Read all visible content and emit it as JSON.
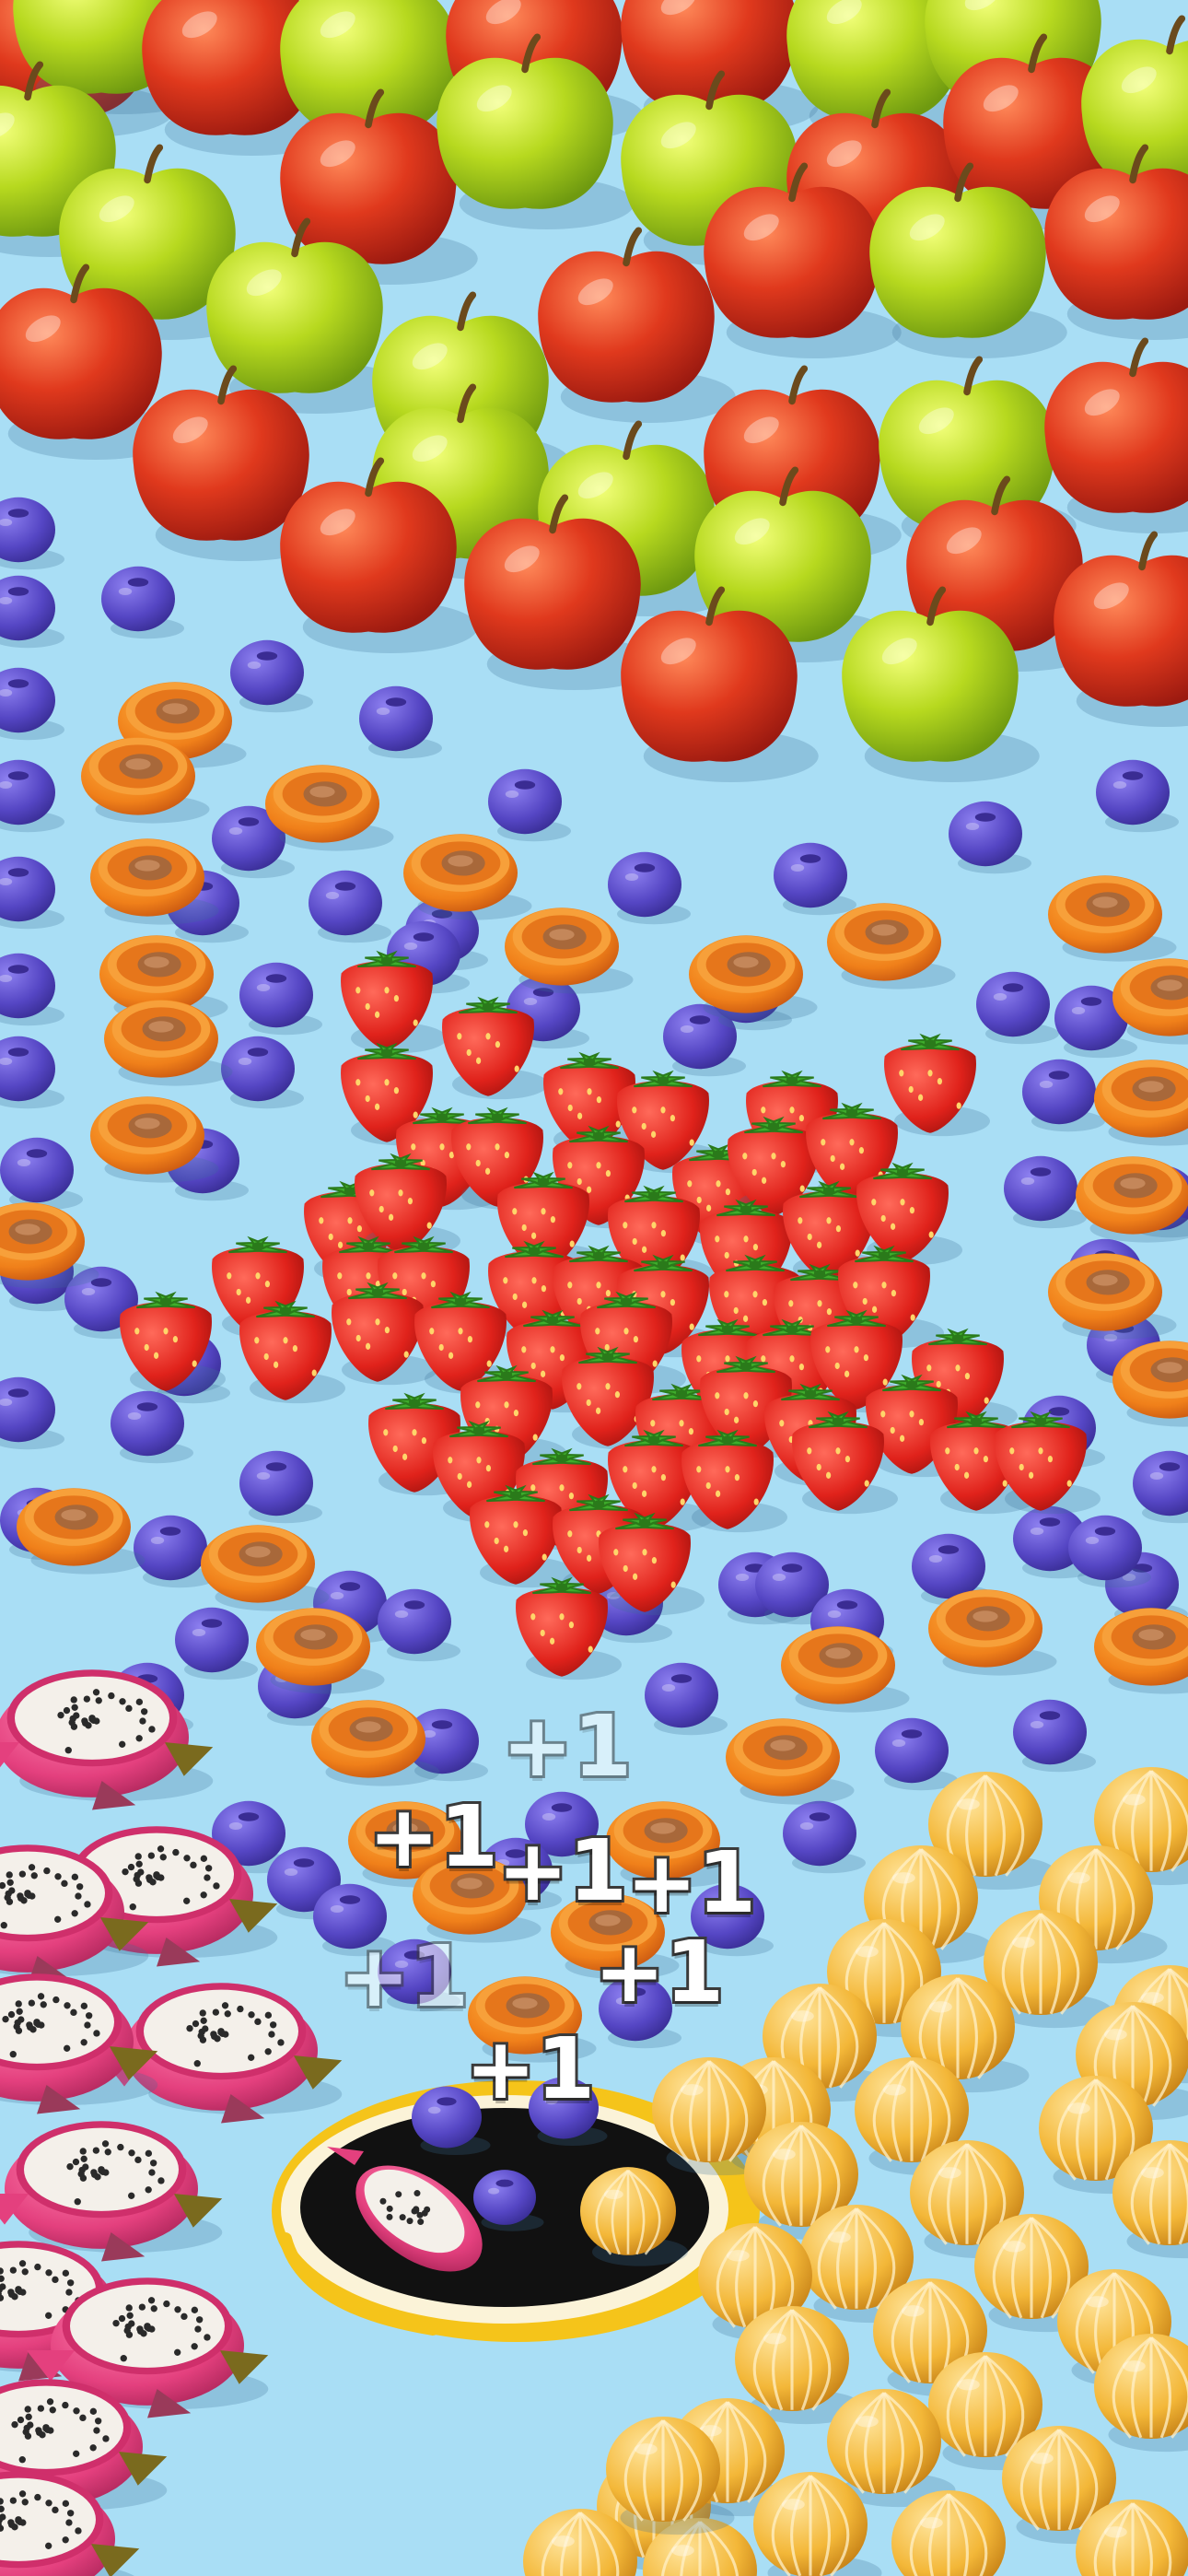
{
  "game": {
    "background_color": "#a9def5",
    "score_popups": [
      "+1",
      "+1",
      "+1",
      "+1",
      "+1",
      "+1",
      "+1"
    ],
    "fruit_types": [
      "red-apple",
      "green-apple",
      "blueberry",
      "apricot-half",
      "strawberry",
      "dragon-fruit",
      "peeled-orange"
    ],
    "colors": {
      "red_apple": "#d93a1f",
      "green_apple": "#b5d922",
      "blueberry": "#5a4bc7",
      "apricot_half": "#f08a1c",
      "strawberry": "#e3231e",
      "dragon_fruit": "#e84d8a",
      "peeled_orange": "#f5b93a",
      "hole_rim": "#f5c41a"
    },
    "hole": {
      "contents": [
        "dragon-fruit",
        "blueberry",
        "blueberry",
        "blueberry",
        "peeled-orange"
      ]
    }
  }
}
